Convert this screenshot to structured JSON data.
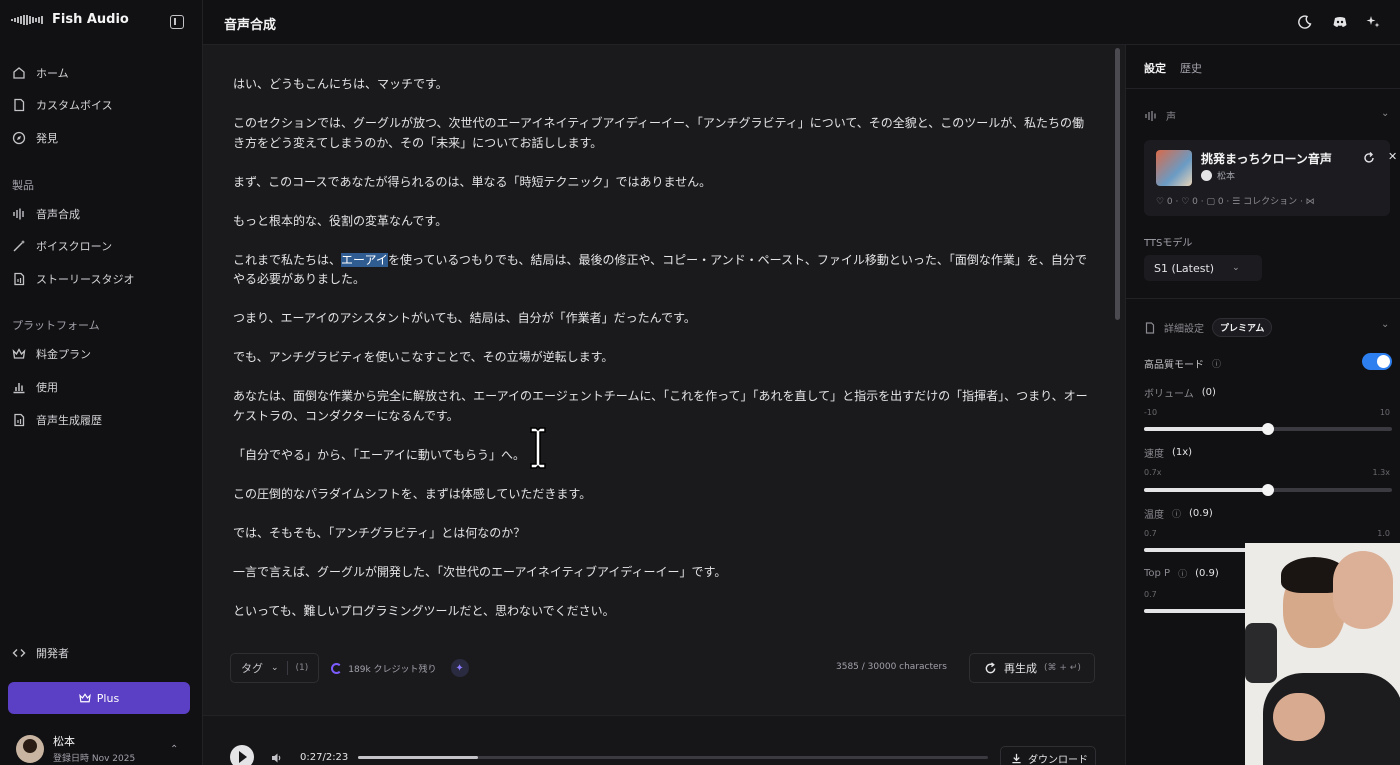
{
  "brand": {
    "name": "Fish Audio"
  },
  "sidebar": {
    "nav": [
      {
        "label": "ホーム"
      },
      {
        "label": "カスタムボイス"
      },
      {
        "label": "発見"
      }
    ],
    "section_products": "製品",
    "products": [
      {
        "label": "音声合成"
      },
      {
        "label": "ボイスクローン"
      },
      {
        "label": "ストーリースタジオ"
      }
    ],
    "section_platform": "プラットフォーム",
    "platform": [
      {
        "label": "料金プラン"
      },
      {
        "label": "使用"
      },
      {
        "label": "音声生成履歴"
      }
    ],
    "developer": "開発者",
    "plus_label": "Plus",
    "user": {
      "name": "松本",
      "sub": "登録日時 Nov 2025"
    }
  },
  "header": {
    "title": "音声合成"
  },
  "editor": {
    "paragraphs": [
      "はい、どうもこんにちは、マッチです。",
      "このセクションでは、グーグルが放つ、次世代のエーアイネイティブアイディーイー、「アンチグラビティ」について、その全貌と、このツールが、私たちの働き方をどう変えてしまうのか、その「未来」についてお話しします。",
      "まず、このコースであなたが得られるのは、単なる「時短テクニック」ではありません。",
      "もっと根本的な、役割の変革なんです。",
      "これまで私たちは、|エーアイ|を使っているつもりでも、結局は、最後の修正や、コピー・アンド・ペースト、ファイル移動といった、「面倒な作業」を、自分でやる必要がありました。",
      "つまり、エーアイのアシスタントがいても、結局は、自分が「作業者」だったんです。",
      "でも、アンチグラビティを使いこなすことで、その立場が逆転します。",
      "あなたは、面倒な作業から完全に解放され、エーアイのエージェントチームに、「これを作って」「あれを直して」と指示を出すだけの「指揮者」、つまり、オーケストラの、コンダクターになるんです。",
      "「自分でやる」から、「エーアイに動いてもらう」へ。",
      "この圧倒的なパラダイムシフトを、まずは体感していただきます。",
      "では、そもそも、「アンチグラビティ」とは何なのか？",
      "一言で言えば、グーグルが開発した、「次世代のエーアイネイティブアイディーイー」です。",
      "といっても、難しいプログラミングツールだと、思わないでください。"
    ],
    "tag_label": "タグ",
    "tag_count": "(1)",
    "credits": "189k クレジット残り",
    "char_count": "3585 / 30000 characters",
    "regenerate_label": "再生成",
    "regenerate_hint": "(⌘ + ↵)"
  },
  "player": {
    "time": "0:27/2:23",
    "progress": 0.19,
    "download_label": "ダウンロード"
  },
  "panel": {
    "tabs": [
      "設定",
      "歴史"
    ],
    "voice_section": "声",
    "voice": {
      "name": "挑発まっちクローン音声",
      "owner": "松本",
      "stats": "♡ 0 · ♡ 0 · ▢ 0 · ☰ コレクション · ⋈"
    },
    "tts_label": "TTSモデル",
    "model": "S1 (Latest)",
    "advanced_label": "詳細設定",
    "premium": "プレミアム",
    "hq_label": "高品質モード",
    "volume_label": "ボリューム",
    "volume_value": "(0)",
    "volume_min": "-10",
    "volume_max": "10",
    "volume_frac": 0.5,
    "speed_label": "速度",
    "speed_value": "(1x)",
    "speed_min": "0.7x",
    "speed_max": "1.3x",
    "speed_frac": 0.5,
    "temp_label": "温度",
    "temp_value": "(0.9)",
    "temp_min": "0.7",
    "temp_max": "1.0",
    "temp_frac": 0.67,
    "topp_label": "Top P",
    "topp_value": "(0.9)",
    "topp_min": "0.7",
    "topp_frac": 0.67
  },
  "colors": {
    "accent": "#5b3fc4",
    "toggle": "#2d7ff0",
    "highlight": "#2f5c91"
  }
}
